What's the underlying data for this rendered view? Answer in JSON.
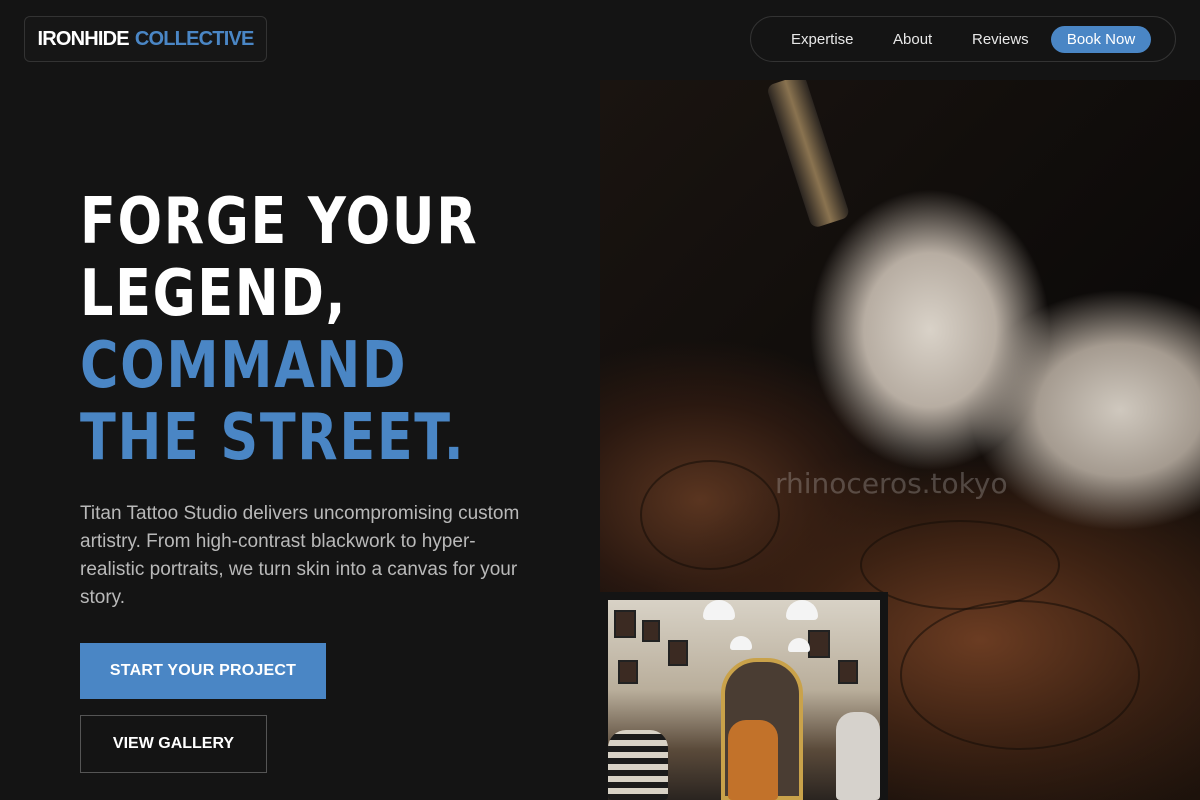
{
  "brand": {
    "part1": "IRONHIDE",
    "part2": "COLLECTIVE",
    "accent_color": "#4a86c5"
  },
  "nav": {
    "items": [
      {
        "label": "Expertise"
      },
      {
        "label": "About"
      },
      {
        "label": "Reviews"
      }
    ],
    "cta": "Book Now"
  },
  "hero": {
    "title_lines": [
      "FORGE YOUR",
      "LEGEND,"
    ],
    "accent_lines": [
      "COMMAND",
      "THE STREET."
    ],
    "description": "Titan Tattoo Studio delivers uncompromising custom artistry. From high-contrast blackwork to hyper-realistic portraits, we turn skin into a canvas for your story.",
    "primary_button": "START YOUR PROJECT",
    "secondary_button": "VIEW GALLERY"
  },
  "images": {
    "main_watermark": "rhinoceros.tokyo"
  }
}
